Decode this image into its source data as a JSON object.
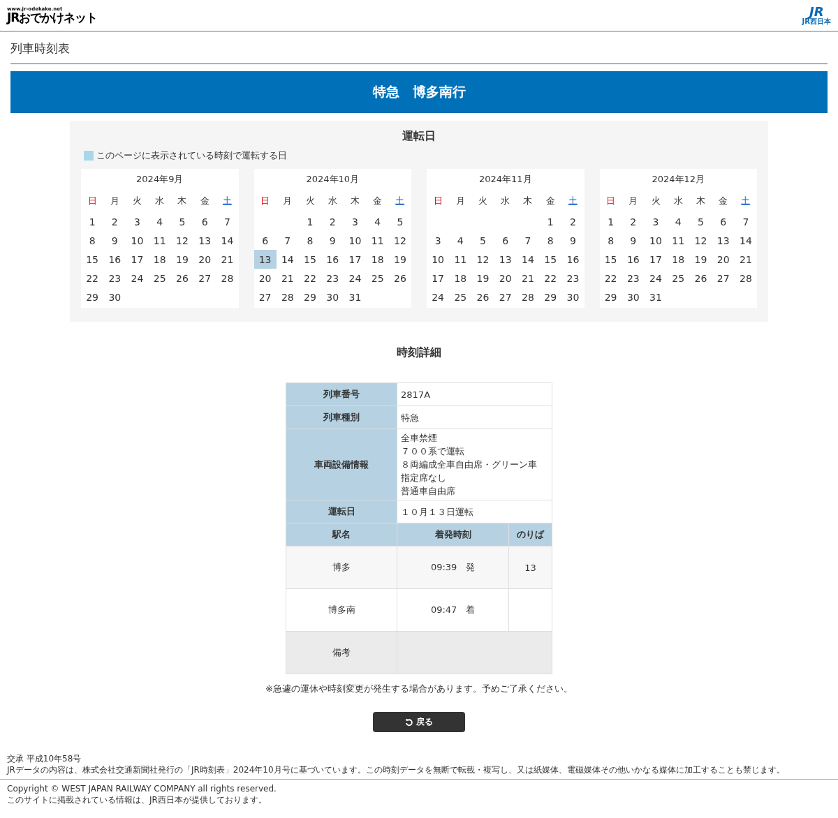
{
  "header": {
    "site_url": "www.jr-odekake.net",
    "site_logo": "JRおでかけネット",
    "corp_logo": "JR",
    "corp_name": "JR西日本"
  },
  "page_title": "列車時刻表",
  "train_banner": "特急　博多南行",
  "calendar": {
    "title": "運転日",
    "legend": "このページに表示されている時刻で運転する日",
    "months": [
      {
        "title": "2024年9月",
        "weekdays": [
          {
            "label": "日",
            "kind": "sun"
          },
          {
            "label": "月",
            "kind": "weekday"
          },
          {
            "label": "火",
            "kind": "weekday"
          },
          {
            "label": "水",
            "kind": "weekday"
          },
          {
            "label": "木",
            "kind": "weekday"
          },
          {
            "label": "金",
            "kind": "weekday"
          },
          {
            "label": "土",
            "kind": "sat"
          }
        ],
        "weeks": [
          [
            {
              "kind": "day",
              "day": "1",
              "runs": false
            },
            {
              "kind": "day",
              "day": "2",
              "runs": false
            },
            {
              "kind": "day",
              "day": "3",
              "runs": false
            },
            {
              "kind": "day",
              "day": "4",
              "runs": false
            },
            {
              "kind": "day",
              "day": "5",
              "runs": false
            },
            {
              "kind": "day",
              "day": "6",
              "runs": false
            },
            {
              "kind": "day",
              "day": "7",
              "runs": false
            }
          ],
          [
            {
              "kind": "day",
              "day": "8",
              "runs": false
            },
            {
              "kind": "day",
              "day": "9",
              "runs": false
            },
            {
              "kind": "day",
              "day": "10",
              "runs": false
            },
            {
              "kind": "day",
              "day": "11",
              "runs": false
            },
            {
              "kind": "day",
              "day": "12",
              "runs": false
            },
            {
              "kind": "day",
              "day": "13",
              "runs": false
            },
            {
              "kind": "day",
              "day": "14",
              "runs": false
            }
          ],
          [
            {
              "kind": "day",
              "day": "15",
              "runs": false
            },
            {
              "kind": "day",
              "day": "16",
              "runs": false
            },
            {
              "kind": "day",
              "day": "17",
              "runs": false
            },
            {
              "kind": "day",
              "day": "18",
              "runs": false
            },
            {
              "kind": "day",
              "day": "19",
              "runs": false
            },
            {
              "kind": "day",
              "day": "20",
              "runs": false
            },
            {
              "kind": "day",
              "day": "21",
              "runs": false
            }
          ],
          [
            {
              "kind": "day",
              "day": "22",
              "runs": false
            },
            {
              "kind": "day",
              "day": "23",
              "runs": false
            },
            {
              "kind": "day",
              "day": "24",
              "runs": false
            },
            {
              "kind": "day",
              "day": "25",
              "runs": false
            },
            {
              "kind": "day",
              "day": "26",
              "runs": false
            },
            {
              "kind": "day",
              "day": "27",
              "runs": false
            },
            {
              "kind": "day",
              "day": "28",
              "runs": false
            }
          ],
          [
            {
              "kind": "day",
              "day": "29",
              "runs": false
            },
            {
              "kind": "day",
              "day": "30",
              "runs": false
            },
            {
              "kind": "blank"
            },
            {
              "kind": "blank"
            },
            {
              "kind": "blank"
            },
            {
              "kind": "blank"
            },
            {
              "kind": "blank"
            }
          ]
        ]
      },
      {
        "title": "2024年10月",
        "weekdays": [
          {
            "label": "日",
            "kind": "sun"
          },
          {
            "label": "月",
            "kind": "weekday"
          },
          {
            "label": "火",
            "kind": "weekday"
          },
          {
            "label": "水",
            "kind": "weekday"
          },
          {
            "label": "木",
            "kind": "weekday"
          },
          {
            "label": "金",
            "kind": "weekday"
          },
          {
            "label": "土",
            "kind": "sat"
          }
        ],
        "weeks": [
          [
            {
              "kind": "blank"
            },
            {
              "kind": "blank"
            },
            {
              "kind": "day",
              "day": "1",
              "runs": false
            },
            {
              "kind": "day",
              "day": "2",
              "runs": false
            },
            {
              "kind": "day",
              "day": "3",
              "runs": false
            },
            {
              "kind": "day",
              "day": "4",
              "runs": false
            },
            {
              "kind": "day",
              "day": "5",
              "runs": false
            }
          ],
          [
            {
              "kind": "day",
              "day": "6",
              "runs": false
            },
            {
              "kind": "day",
              "day": "7",
              "runs": false
            },
            {
              "kind": "day",
              "day": "8",
              "runs": false
            },
            {
              "kind": "day",
              "day": "9",
              "runs": false
            },
            {
              "kind": "day",
              "day": "10",
              "runs": false
            },
            {
              "kind": "day",
              "day": "11",
              "runs": false
            },
            {
              "kind": "day",
              "day": "12",
              "runs": false
            }
          ],
          [
            {
              "kind": "day",
              "day": "13",
              "runs": true
            },
            {
              "kind": "day",
              "day": "14",
              "runs": false
            },
            {
              "kind": "day",
              "day": "15",
              "runs": false
            },
            {
              "kind": "day",
              "day": "16",
              "runs": false
            },
            {
              "kind": "day",
              "day": "17",
              "runs": false
            },
            {
              "kind": "day",
              "day": "18",
              "runs": false
            },
            {
              "kind": "day",
              "day": "19",
              "runs": false
            }
          ],
          [
            {
              "kind": "day",
              "day": "20",
              "runs": false
            },
            {
              "kind": "day",
              "day": "21",
              "runs": false
            },
            {
              "kind": "day",
              "day": "22",
              "runs": false
            },
            {
              "kind": "day",
              "day": "23",
              "runs": false
            },
            {
              "kind": "day",
              "day": "24",
              "runs": false
            },
            {
              "kind": "day",
              "day": "25",
              "runs": false
            },
            {
              "kind": "day",
              "day": "26",
              "runs": false
            }
          ],
          [
            {
              "kind": "day",
              "day": "27",
              "runs": false
            },
            {
              "kind": "day",
              "day": "28",
              "runs": false
            },
            {
              "kind": "day",
              "day": "29",
              "runs": false
            },
            {
              "kind": "day",
              "day": "30",
              "runs": false
            },
            {
              "kind": "day",
              "day": "31",
              "runs": false
            },
            {
              "kind": "blank"
            },
            {
              "kind": "blank"
            }
          ]
        ]
      },
      {
        "title": "2024年11月",
        "weekdays": [
          {
            "label": "日",
            "kind": "sun"
          },
          {
            "label": "月",
            "kind": "weekday"
          },
          {
            "label": "火",
            "kind": "weekday"
          },
          {
            "label": "水",
            "kind": "weekday"
          },
          {
            "label": "木",
            "kind": "weekday"
          },
          {
            "label": "金",
            "kind": "weekday"
          },
          {
            "label": "土",
            "kind": "sat"
          }
        ],
        "weeks": [
          [
            {
              "kind": "blank"
            },
            {
              "kind": "blank"
            },
            {
              "kind": "blank"
            },
            {
              "kind": "blank"
            },
            {
              "kind": "blank"
            },
            {
              "kind": "day",
              "day": "1",
              "runs": false
            },
            {
              "kind": "day",
              "day": "2",
              "runs": false
            }
          ],
          [
            {
              "kind": "day",
              "day": "3",
              "runs": false
            },
            {
              "kind": "day",
              "day": "4",
              "runs": false
            },
            {
              "kind": "day",
              "day": "5",
              "runs": false
            },
            {
              "kind": "day",
              "day": "6",
              "runs": false
            },
            {
              "kind": "day",
              "day": "7",
              "runs": false
            },
            {
              "kind": "day",
              "day": "8",
              "runs": false
            },
            {
              "kind": "day",
              "day": "9",
              "runs": false
            }
          ],
          [
            {
              "kind": "day",
              "day": "10",
              "runs": false
            },
            {
              "kind": "day",
              "day": "11",
              "runs": false
            },
            {
              "kind": "day",
              "day": "12",
              "runs": false
            },
            {
              "kind": "day",
              "day": "13",
              "runs": false
            },
            {
              "kind": "day",
              "day": "14",
              "runs": false
            },
            {
              "kind": "day",
              "day": "15",
              "runs": false
            },
            {
              "kind": "day",
              "day": "16",
              "runs": false
            }
          ],
          [
            {
              "kind": "day",
              "day": "17",
              "runs": false
            },
            {
              "kind": "day",
              "day": "18",
              "runs": false
            },
            {
              "kind": "day",
              "day": "19",
              "runs": false
            },
            {
              "kind": "day",
              "day": "20",
              "runs": false
            },
            {
              "kind": "day",
              "day": "21",
              "runs": false
            },
            {
              "kind": "day",
              "day": "22",
              "runs": false
            },
            {
              "kind": "day",
              "day": "23",
              "runs": false
            }
          ],
          [
            {
              "kind": "day",
              "day": "24",
              "runs": false
            },
            {
              "kind": "day",
              "day": "25",
              "runs": false
            },
            {
              "kind": "day",
              "day": "26",
              "runs": false
            },
            {
              "kind": "day",
              "day": "27",
              "runs": false
            },
            {
              "kind": "day",
              "day": "28",
              "runs": false
            },
            {
              "kind": "day",
              "day": "29",
              "runs": false
            },
            {
              "kind": "day",
              "day": "30",
              "runs": false
            }
          ]
        ]
      },
      {
        "title": "2024年12月",
        "weekdays": [
          {
            "label": "日",
            "kind": "sun"
          },
          {
            "label": "月",
            "kind": "weekday"
          },
          {
            "label": "火",
            "kind": "weekday"
          },
          {
            "label": "水",
            "kind": "weekday"
          },
          {
            "label": "木",
            "kind": "weekday"
          },
          {
            "label": "金",
            "kind": "weekday"
          },
          {
            "label": "土",
            "kind": "sat"
          }
        ],
        "weeks": [
          [
            {
              "kind": "day",
              "day": "1",
              "runs": false
            },
            {
              "kind": "day",
              "day": "2",
              "runs": false
            },
            {
              "kind": "day",
              "day": "3",
              "runs": false
            },
            {
              "kind": "day",
              "day": "4",
              "runs": false
            },
            {
              "kind": "day",
              "day": "5",
              "runs": false
            },
            {
              "kind": "day",
              "day": "6",
              "runs": false
            },
            {
              "kind": "day",
              "day": "7",
              "runs": false
            }
          ],
          [
            {
              "kind": "day",
              "day": "8",
              "runs": false
            },
            {
              "kind": "day",
              "day": "9",
              "runs": false
            },
            {
              "kind": "day",
              "day": "10",
              "runs": false
            },
            {
              "kind": "day",
              "day": "11",
              "runs": false
            },
            {
              "kind": "day",
              "day": "12",
              "runs": false
            },
            {
              "kind": "day",
              "day": "13",
              "runs": false
            },
            {
              "kind": "day",
              "day": "14",
              "runs": false
            }
          ],
          [
            {
              "kind": "day",
              "day": "15",
              "runs": false
            },
            {
              "kind": "day",
              "day": "16",
              "runs": false
            },
            {
              "kind": "day",
              "day": "17",
              "runs": false
            },
            {
              "kind": "day",
              "day": "18",
              "runs": false
            },
            {
              "kind": "day",
              "day": "19",
              "runs": false
            },
            {
              "kind": "day",
              "day": "20",
              "runs": false
            },
            {
              "kind": "day",
              "day": "21",
              "runs": false
            }
          ],
          [
            {
              "kind": "day",
              "day": "22",
              "runs": false
            },
            {
              "kind": "day",
              "day": "23",
              "runs": false
            },
            {
              "kind": "day",
              "day": "24",
              "runs": false
            },
            {
              "kind": "day",
              "day": "25",
              "runs": false
            },
            {
              "kind": "day",
              "day": "26",
              "runs": false
            },
            {
              "kind": "day",
              "day": "27",
              "runs": false
            },
            {
              "kind": "day",
              "day": "28",
              "runs": false
            }
          ],
          [
            {
              "kind": "day",
              "day": "29",
              "runs": false
            },
            {
              "kind": "day",
              "day": "30",
              "runs": false
            },
            {
              "kind": "day",
              "day": "31",
              "runs": false
            },
            {
              "kind": "blank"
            },
            {
              "kind": "blank"
            },
            {
              "kind": "blank"
            },
            {
              "kind": "blank"
            }
          ]
        ]
      }
    ]
  },
  "details": {
    "title": "時刻詳細",
    "info_rows": [
      {
        "label": "列車番号",
        "lines": [
          "2817A"
        ]
      },
      {
        "label": "列車種別",
        "lines": [
          "特急"
        ]
      },
      {
        "label": "車両設備情報",
        "lines": [
          "全車禁煙",
          "７００系で運転",
          "８両編成全車自由席・グリーン車",
          "指定席なし",
          "普通車自由席"
        ]
      },
      {
        "label": "運転日",
        "lines": [
          "１０月１３日運転"
        ]
      }
    ],
    "columns": [
      "駅名",
      "着発時刻",
      "のりば"
    ],
    "stops": [
      {
        "station": "博多",
        "time": "09:39　発",
        "platform": "13"
      },
      {
        "station": "博多南",
        "time": "09:47　着"
      }
    ],
    "remarks_label": "備考"
  },
  "notice": "※急遽の運休や時刻変更が発生する場合があります。予めご了承ください。",
  "back_button": "戻る",
  "footer": {
    "lines": [
      "交承 平成10年58号",
      "JRデータの内容は、株式会社交通新聞社発行の「JR時刻表」2024年10月号に基づいています。この時刻データを無断で転載・複写し、又は紙媒体、電磁媒体その他いかなる媒体に加工することも禁じます。"
    ],
    "copyright": "Copyright © WEST JAPAN RAILWAY COMPANY all rights reserved.",
    "provider": "このサイトに掲載されている情報は、JR西日本が提供しております。"
  }
}
